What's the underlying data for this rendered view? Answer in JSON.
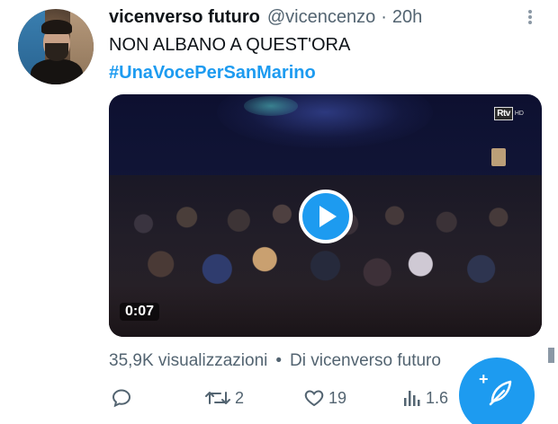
{
  "tweet": {
    "author_name": "vicenverso futuro",
    "handle": "@vicencenzo",
    "separator": "·",
    "time": "20h",
    "text": "NON ALBANO A QUEST'ORA",
    "hashtag": "#UnaVocePerSanMarino"
  },
  "video": {
    "duration": "0:07",
    "channel_logo": "Rtv",
    "channel_logo_suffix": "HD",
    "play_icon": "play-icon"
  },
  "meta": {
    "views": "35,9K visualizzazioni",
    "dot": "•",
    "source": "Di vicenverso futuro"
  },
  "actions": {
    "reply_icon": "reply-icon",
    "retweet_icon": "retweet-icon",
    "retweet_count": "2",
    "like_icon": "heart-icon",
    "like_count": "19",
    "views_icon": "analytics-icon",
    "views_count": "1.6"
  },
  "fab": {
    "icon": "compose-feather-icon",
    "plus": "+"
  },
  "colors": {
    "accent": "#1d9bf0",
    "text_primary": "#0f1419",
    "text_secondary": "#536471",
    "background": "#ffffff"
  }
}
